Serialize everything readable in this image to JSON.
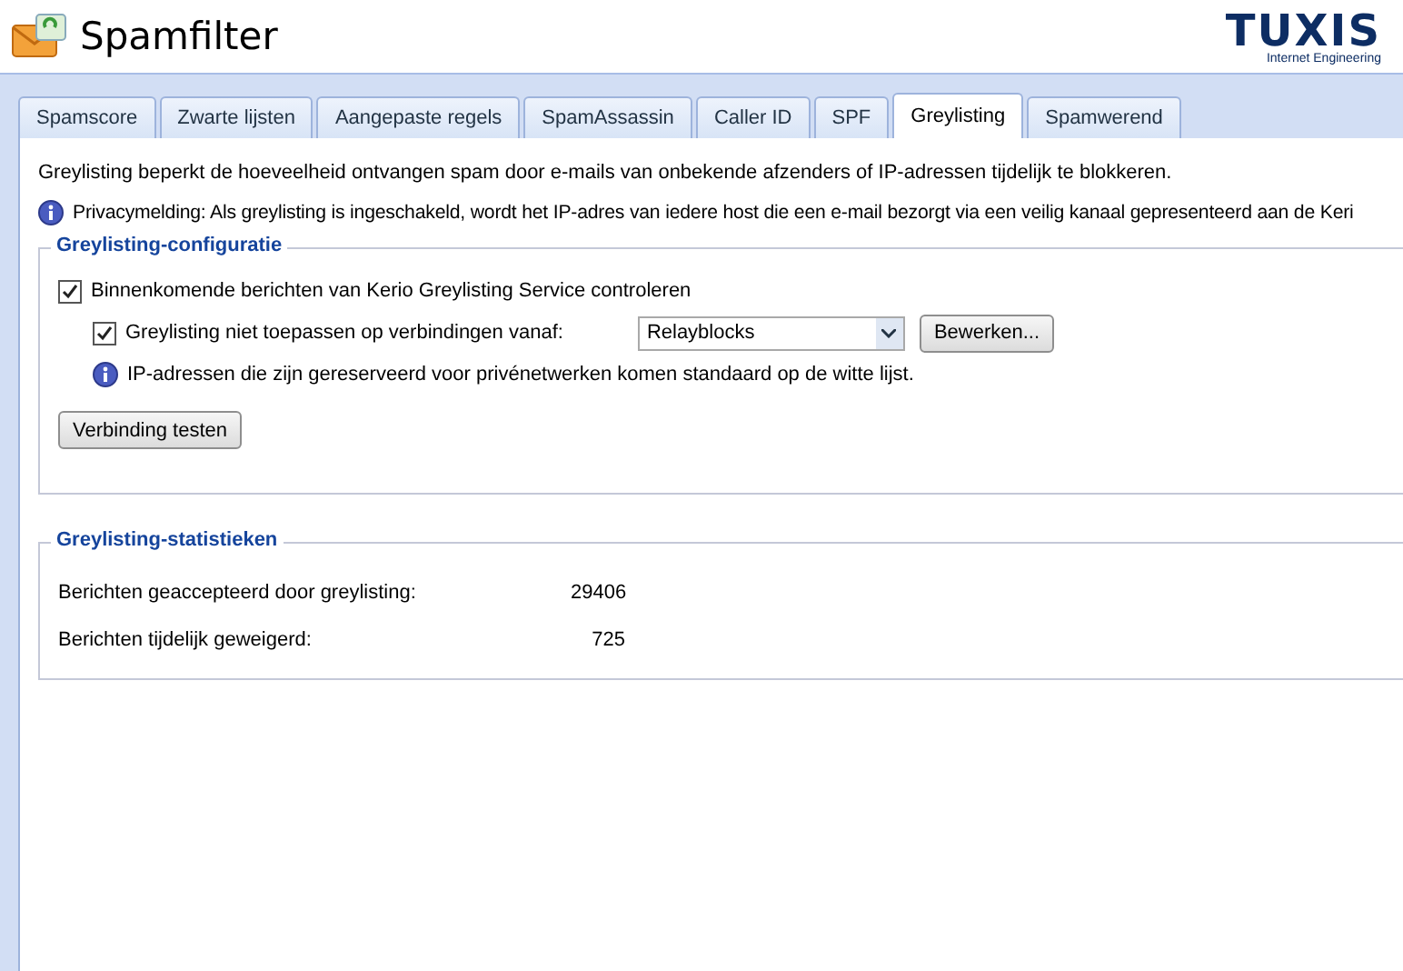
{
  "header": {
    "title": "Spamfilter",
    "logo": {
      "name": "TUXIS",
      "tagline": "Internet Engineering"
    }
  },
  "tabs": [
    {
      "label": "Spamscore",
      "selected": false
    },
    {
      "label": "Zwarte lijsten",
      "selected": false
    },
    {
      "label": "Aangepaste regels",
      "selected": false
    },
    {
      "label": "SpamAssassin",
      "selected": false
    },
    {
      "label": "Caller ID",
      "selected": false
    },
    {
      "label": "SPF",
      "selected": false
    },
    {
      "label": "Greylisting",
      "selected": true
    },
    {
      "label": "Spamwerend",
      "selected": false
    }
  ],
  "intro": "Greylisting beperkt de hoeveelheid ontvangen spam door e-mails van onbekende afzenders of IP-adressen tijdelijk te blokkeren.",
  "privacy_note": "Privacymelding: Als greylisting is ingeschakeld, wordt het IP-adres van iedere host die een e-mail bezorgt via een veilig kanaal gepresenteerd aan de Keri",
  "configuration": {
    "title": "Greylisting-configuratie",
    "enable": {
      "label": "Binnenkomende berichten van Kerio Greylisting Service controleren",
      "checked": true
    },
    "exception": {
      "label": "Greylisting niet toepassen op verbindingen vanaf:",
      "checked": true,
      "value": "Relayblocks",
      "edit_button": "Bewerken..."
    },
    "info": "IP-adressen die zijn gereserveerd voor privénetwerken komen standaard op de witte lijst.",
    "test_button": "Verbinding testen"
  },
  "statistics": {
    "title": "Greylisting-statistieken",
    "rows": [
      {
        "label": "Berichten geaccepteerd door greylisting:",
        "value": "29406"
      },
      {
        "label": "Berichten tijdelijk geweigerd:",
        "value": "725"
      }
    ]
  }
}
